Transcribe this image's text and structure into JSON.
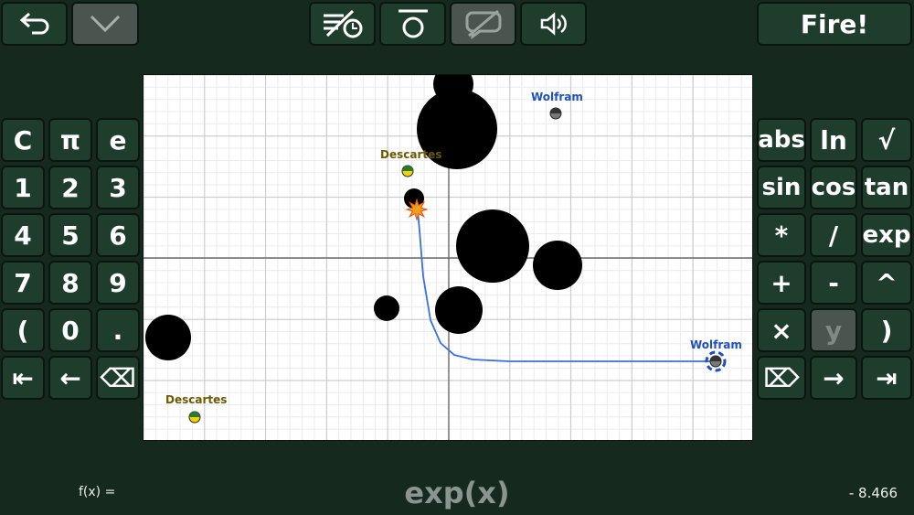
{
  "toolbar": {
    "back_icon": "undo-arrow-icon",
    "collapse_icon": "chevron-down-icon",
    "no_timer_icon": "crossed-lines-clock-icon",
    "circle_icon": "overline-circle-icon",
    "no_chat_icon": "crossed-speech-bubble-icon",
    "sound_icon": "speaker-icon",
    "fire_label": "Fire!"
  },
  "keypad_left": [
    "C",
    "π",
    "e",
    "1",
    "2",
    "3",
    "4",
    "5",
    "6",
    "7",
    "8",
    "9",
    "(",
    "0",
    ".",
    "⇤",
    "←",
    "⌫"
  ],
  "keypad_right": [
    "abs",
    "ln",
    "√",
    "sin",
    "cos",
    "tan",
    "*",
    "/",
    "exp",
    "+",
    "-",
    "^",
    "×",
    "y",
    ")",
    "⌦",
    "→",
    "⇥"
  ],
  "players": [
    {
      "name": "Wolfram",
      "color": "#1f4fc1"
    },
    {
      "name": "Descartes",
      "color": "#6b5a00"
    },
    {
      "name": "Wolfram",
      "color": "#1f4fc1"
    },
    {
      "name": "Descartes",
      "color": "#6b5a00"
    }
  ],
  "formula": {
    "label": "f(x) =",
    "expression": "exp(x)",
    "value": "- 8.466"
  }
}
